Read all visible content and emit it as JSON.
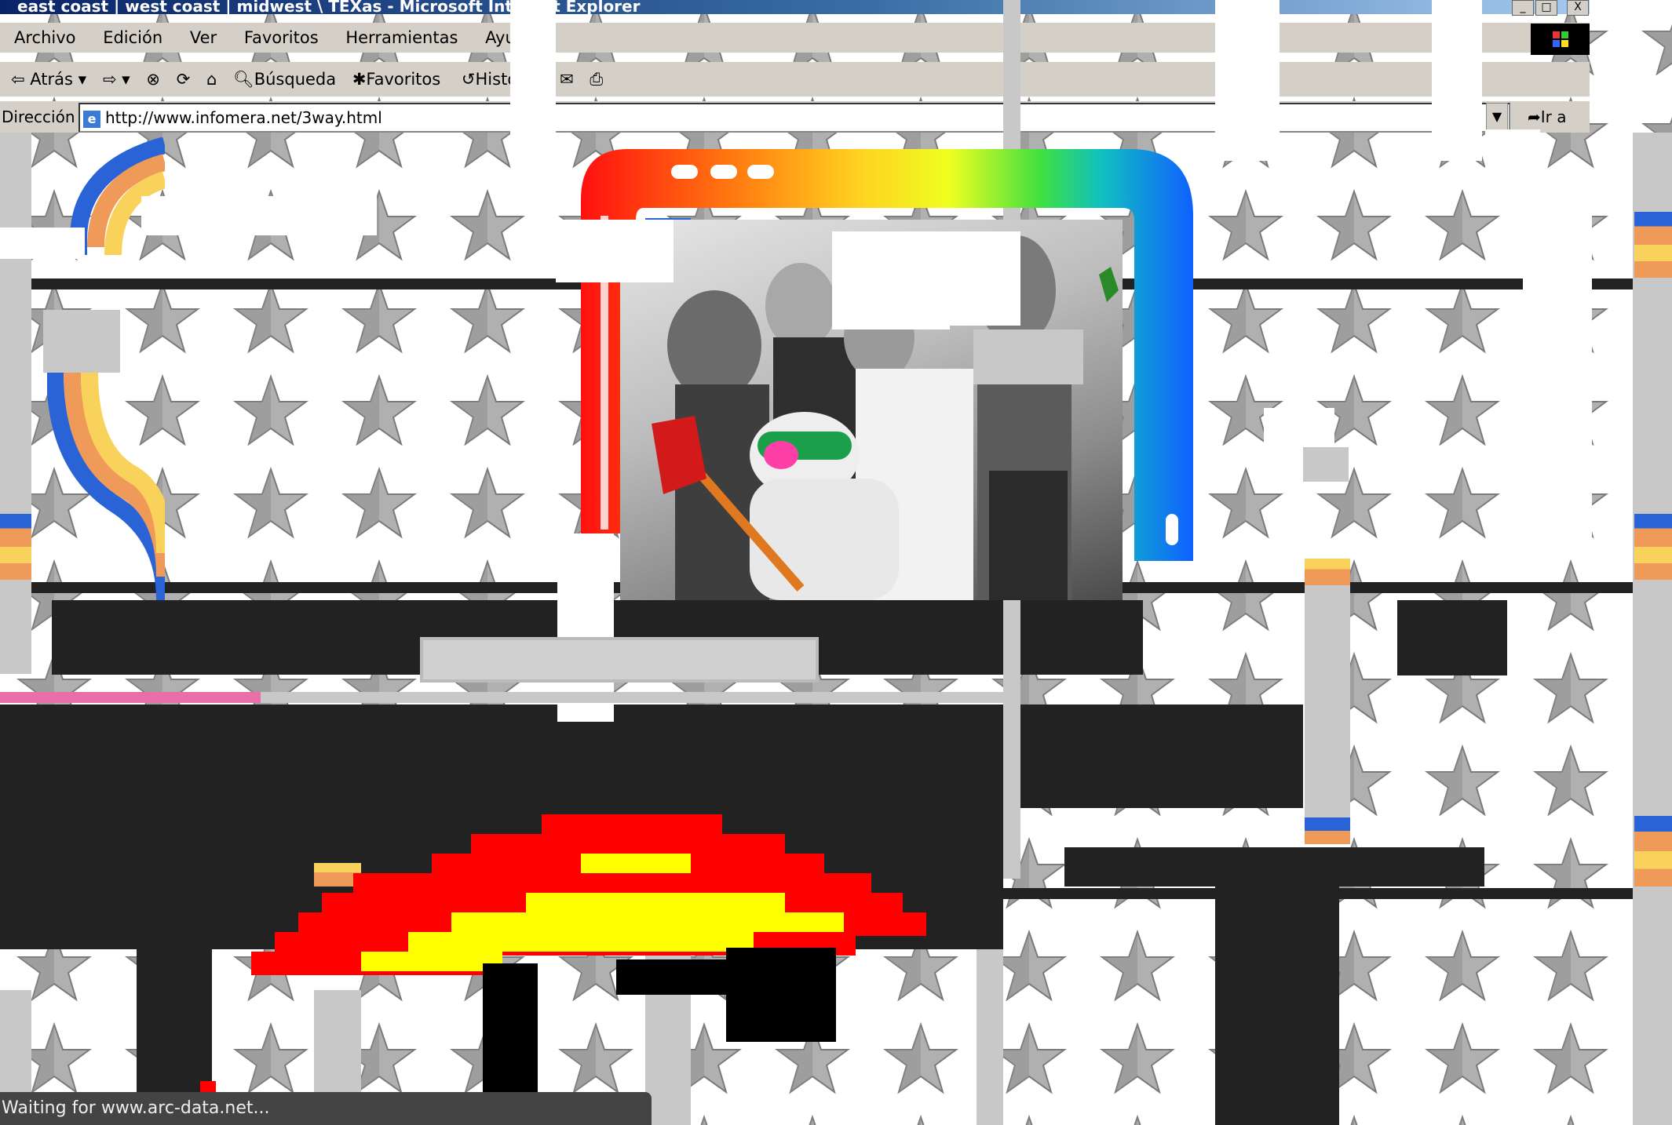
{
  "window": {
    "title": "east coast | west coast | midwest \\ TEXas - Microsoft Internet Explorer",
    "buttons": [
      "_",
      "□",
      "X"
    ]
  },
  "menubar": {
    "items": [
      "Archivo",
      "Edición",
      "Ver",
      "Favoritos",
      "Herramientas",
      "Ayuda"
    ]
  },
  "toolbar": {
    "back_label": "Atrás",
    "search_label": "Búsqueda",
    "favorites_label": "Favoritos",
    "history_label": "Historial"
  },
  "addressbar": {
    "label": "Dirección",
    "url": "http://www.infomera.net/3way.html",
    "go_label": "Ir a"
  },
  "statusbar": {
    "text": "Waiting for www.arc-data.net..."
  },
  "colors": {
    "title_gradient_start": "#0a246a",
    "chrome": "#d4d0c8",
    "page_black": "#222222",
    "star_gray": "#a0a0a0",
    "pink_progress": "#e96fa8"
  },
  "icons": [
    "back-arrow-icon",
    "forward-arrow-icon",
    "stop-icon",
    "refresh-icon",
    "home-icon",
    "search-icon",
    "favorites-icon",
    "history-icon",
    "mail-icon",
    "print-icon",
    "windows-logo-icon",
    "ie-page-icon",
    "go-arrow-icon"
  ],
  "page": {
    "loading_progress": 0.26
  }
}
